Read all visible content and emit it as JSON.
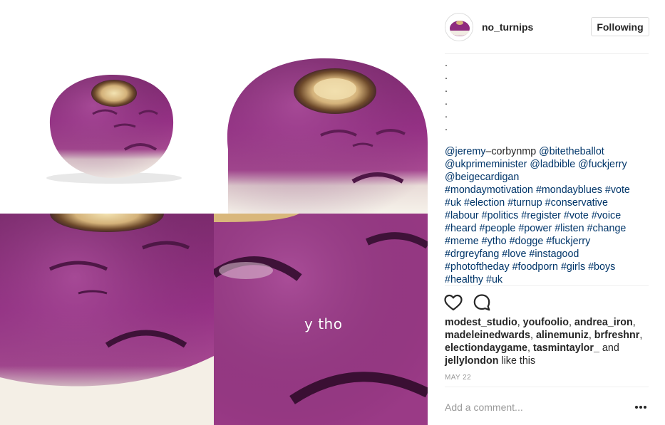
{
  "post": {
    "overlay_text": "y tho",
    "colors": {
      "turnip_purple": "#8e2a7e",
      "turnip_white": "#f3efe6",
      "link": "#003569",
      "muted": "#999999"
    }
  },
  "header": {
    "username": "no_turnips",
    "follow_label": "Following"
  },
  "caption": {
    "dots": [
      ".",
      ".",
      ".",
      ".",
      ".",
      "."
    ],
    "lines": [
      [
        "@jeremy",
        "–corbynmp",
        " @bitetheballot"
      ],
      [
        "@ukprimeminister @ladbible @fuckjerry"
      ],
      [
        "@beigecardigan"
      ],
      [
        "#mondaymotivation #mondayblues #vote"
      ],
      [
        "#uk #election #turnup #conservative"
      ],
      [
        "#labour #politics #register #vote #voice"
      ],
      [
        "#heard #people #power #listen #change"
      ],
      [
        "#meme #ytho #dogge #fuckjerry"
      ],
      [
        "#drgreyfang #love #instagood"
      ],
      [
        "#photoftheday #foodporn #girls #boys"
      ],
      [
        "#healthy #uk"
      ]
    ]
  },
  "actions": {
    "like_icon": "heart-icon",
    "comment_icon": "comment-icon"
  },
  "likes": {
    "users": [
      "modest_studio",
      "youfoolio",
      "andrea_iron",
      "madeleinedwards",
      "alinemuniz",
      "brfreshnr",
      "electiondaygame",
      "tasmintaylor_",
      "jellylondon"
    ],
    "and_text": "and",
    "suffix": "like this"
  },
  "date": "MAY 22",
  "comment": {
    "placeholder": "Add a comment...",
    "more_icon": "more-options-icon"
  }
}
